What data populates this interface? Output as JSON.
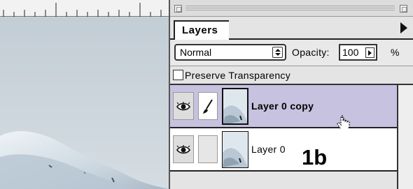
{
  "palette": {
    "tab_label": "Layers",
    "blend_mode": "Normal",
    "opacity_label": "Opacity:",
    "opacity_value": "100",
    "opacity_unit": "%",
    "preserve_transparency_label": "Preserve Transparency",
    "preserve_transparency_checked": false,
    "highlight_color": "#c7c2e0",
    "layers": [
      {
        "name": "Layer 0 copy",
        "visible": true,
        "selected": true,
        "brush_icon": "paintbrush-icon"
      },
      {
        "name": "Layer 0",
        "visible": true,
        "selected": false,
        "brush_icon": ""
      }
    ],
    "figure_label": "1b"
  },
  "icons": {
    "eye": "eye-icon",
    "brush": "paintbrush-icon",
    "cursor": "hand-cursor-icon",
    "menu": "palette-menu-arrow-icon"
  }
}
